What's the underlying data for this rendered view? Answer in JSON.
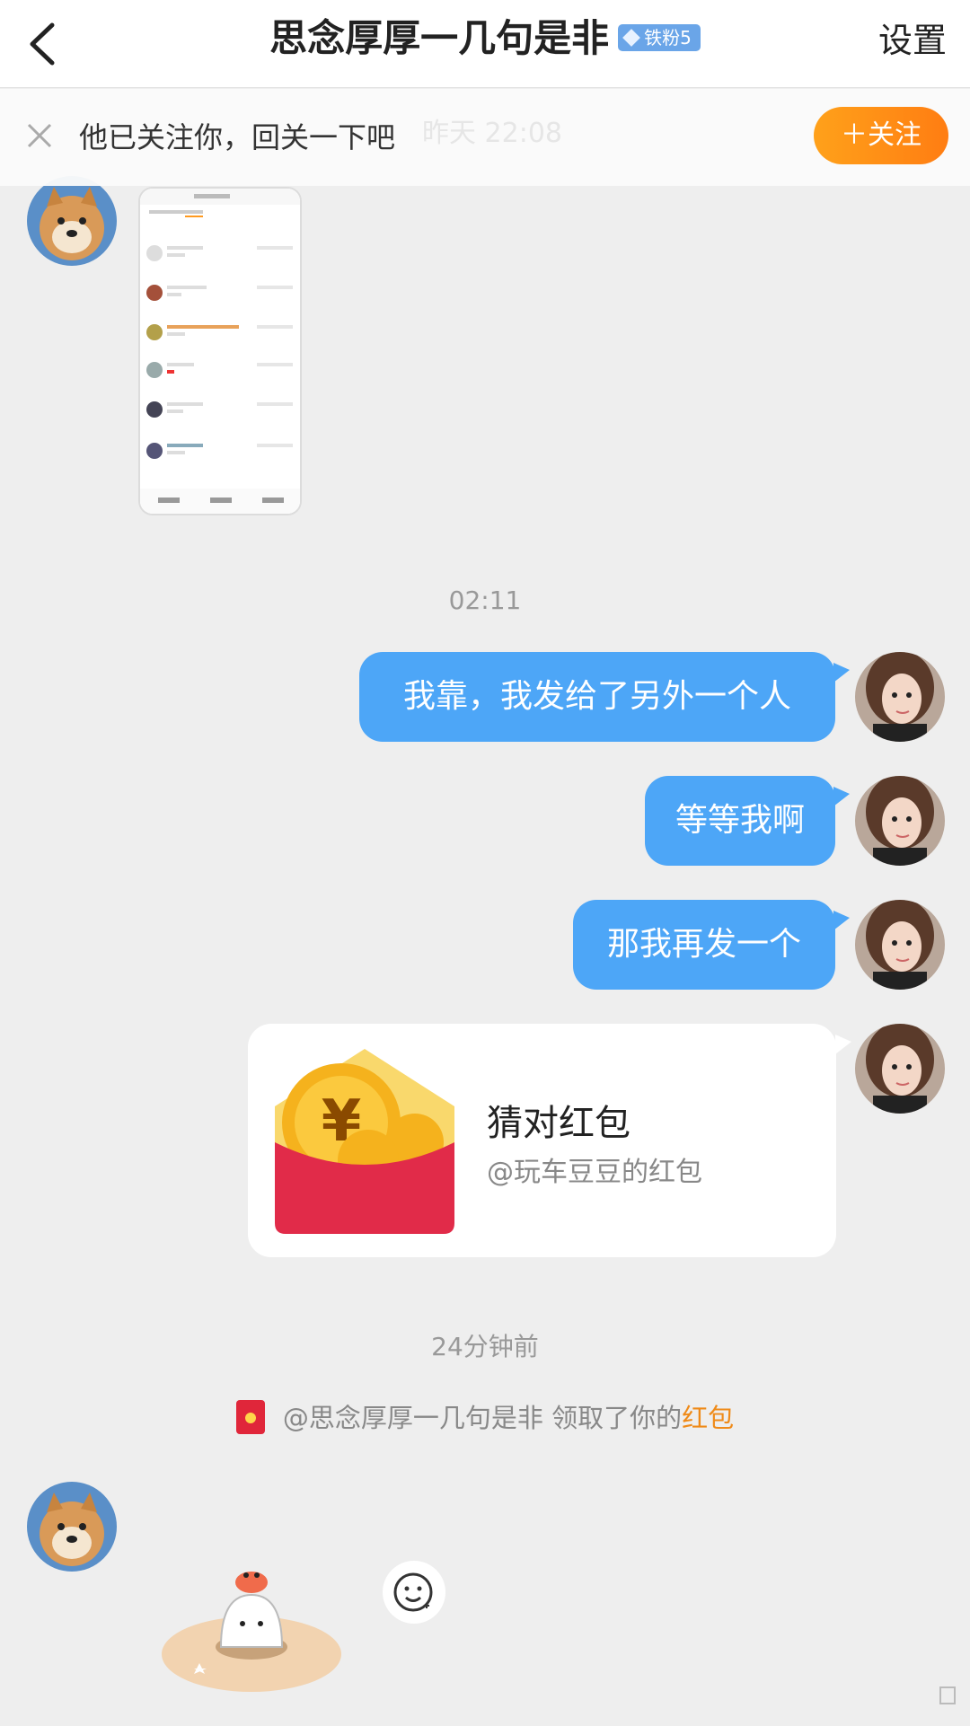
{
  "header": {
    "back_icon": "chevron-left-icon",
    "title": "思念厚厚一几句是非",
    "badge": "铁粉5",
    "settings": "设置"
  },
  "follow_bar": {
    "text": "他已关注你，回关一下吧",
    "ghost_time": "昨天 22:08",
    "button": "＋关注"
  },
  "chat": {
    "time_1": "02:11",
    "messages": [
      "我靠，我发给了另外一个人",
      "等等我啊",
      "那我再发一个"
    ],
    "red_packet": {
      "title": "猜对红包",
      "sub": "@玩车豆豆的红包"
    },
    "time_2": "24分钟前",
    "notice": {
      "prefix": "@思念厚厚一几句是非 领取了你的",
      "link": "红包"
    }
  },
  "colors": {
    "bubble": "#4da6f7",
    "follow_button": "#ff8c16",
    "link": "#ef8a18",
    "red_packet": "#e0263a"
  }
}
